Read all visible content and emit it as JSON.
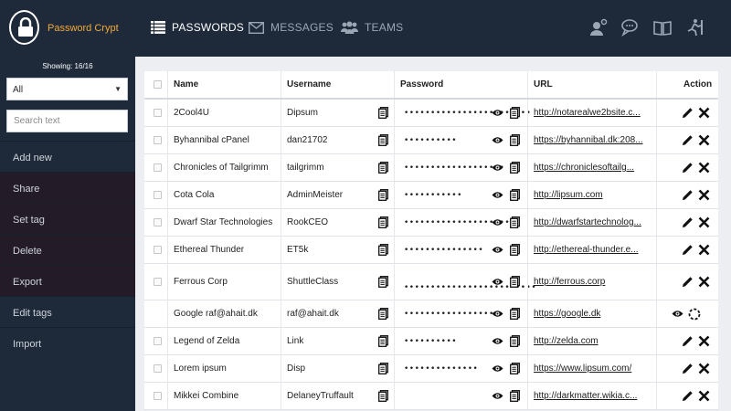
{
  "app": {
    "name": "Password Crypt"
  },
  "nav": {
    "passwords": "PASSWORDS",
    "messages": "MESSAGES",
    "teams": "TEAMS"
  },
  "sidebar": {
    "showing": "Showing: 16/16",
    "filter_value": "All",
    "search_placeholder": "Search text",
    "items": [
      "Add new",
      "Share",
      "Set tag",
      "Delete",
      "Export",
      "Edit tags",
      "Import"
    ]
  },
  "table": {
    "headers": {
      "name": "Name",
      "username": "Username",
      "password": "Password",
      "url": "URL",
      "action": "Action"
    },
    "rows": [
      {
        "name": "2Cool4U",
        "username": "Dipsum",
        "password": "••••••••••••••••••••••••",
        "url": "http://notarealwe2bsite.c..."
      },
      {
        "name": "Byhannibal cPanel",
        "username": "dan21702",
        "password": "••••••••••",
        "url": "https://byhannibal.dk:208..."
      },
      {
        "name": "Chronicles of Tailgrimm",
        "username": "tailgrimm",
        "password": "•••••••••••••••••••",
        "url": "https://chroniclesoftailg..."
      },
      {
        "name": "Cota Cola",
        "username": "AdminMeister",
        "password": "•••••••••••",
        "url": "http://lipsum.com"
      },
      {
        "name": "Dwarf Star Technologies",
        "username": "RookCEO",
        "password": "•••••••••••••••••••••",
        "url": "http://dwarfstartechnolog..."
      },
      {
        "name": "Ethereal Thunder",
        "username": "ET5k",
        "password": "•••••••••••••••",
        "url": "http://ethereal-thunder.e..."
      },
      {
        "name": "Ferrous Corp",
        "username": "ShuttleClass",
        "password": "•••••••••••••••••••••••••",
        "url": "http://ferrous.corp"
      },
      {
        "name": "Google raf@ahait.dk",
        "username": "raf@ahait.dk",
        "password": "•••••••••••••••••",
        "url": "https://google.dk"
      },
      {
        "name": "Legend of Zelda",
        "username": "Link",
        "password": "••••••••••",
        "url": "http://zelda.com"
      },
      {
        "name": "Lorem ipsum",
        "username": "Disp",
        "password": "••••••••••••••",
        "url": "https://www.lipsum.com/"
      },
      {
        "name": "Mikkei Combine",
        "username": "DelaneyTruffault",
        "password": "",
        "url": "http://darkmatter.wikia.c..."
      }
    ]
  },
  "colors": {
    "accent": "#f2a93b",
    "topbar": "#1e2a3a",
    "sidebar_dark": "#241b29"
  }
}
